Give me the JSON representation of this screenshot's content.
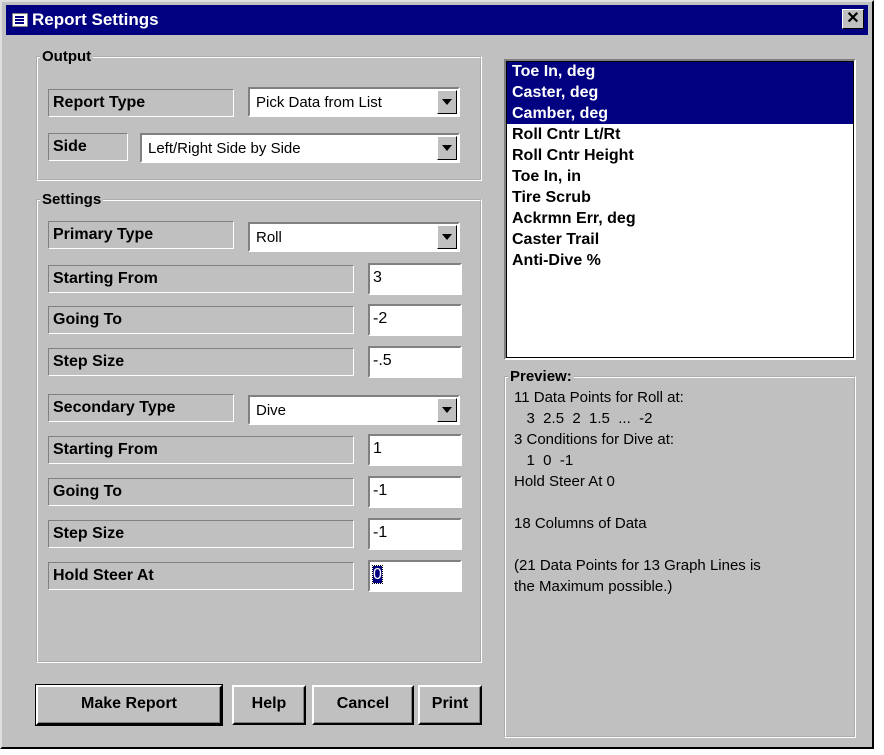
{
  "window": {
    "title": "Report Settings",
    "close_label": "✕"
  },
  "output": {
    "legend": "Output",
    "report_type_label": "Report Type",
    "report_type_value": "Pick Data from List",
    "side_label": "Side",
    "side_value": "Left/Right Side by Side"
  },
  "settings": {
    "legend": "Settings",
    "primary_type_label": "Primary Type",
    "primary_type_value": "Roll",
    "primary_start_label": "Starting From",
    "primary_start_value": "3",
    "primary_goto_label": "Going To",
    "primary_goto_value": "-2",
    "primary_step_label": "Step Size",
    "primary_step_value": "-.5",
    "secondary_type_label": "Secondary Type",
    "secondary_type_value": "Dive",
    "secondary_start_label": "Starting From",
    "secondary_start_value": "1",
    "secondary_goto_label": "Going To",
    "secondary_goto_value": "-1",
    "secondary_step_label": "Step Size",
    "secondary_step_value": "-1",
    "hold_steer_label": "Hold Steer At",
    "hold_steer_value": "0"
  },
  "data_list": {
    "items": [
      {
        "label": "Toe In, deg",
        "selected": true
      },
      {
        "label": "Caster, deg",
        "selected": true
      },
      {
        "label": "Camber, deg",
        "selected": true
      },
      {
        "label": "Roll Cntr Lt/Rt",
        "selected": false
      },
      {
        "label": "Roll Cntr Height",
        "selected": false
      },
      {
        "label": "Toe In, in",
        "selected": false
      },
      {
        "label": "Tire Scrub",
        "selected": false
      },
      {
        "label": "Ackrmn Err, deg",
        "selected": false
      },
      {
        "label": "Caster Trail",
        "selected": false
      },
      {
        "label": "Anti-Dive %",
        "selected": false
      }
    ]
  },
  "preview": {
    "legend": "Preview:",
    "lines": [
      "11 Data Points for Roll at:",
      "   3  2.5  2  1.5  ...  -2",
      "3 Conditions for Dive at:",
      "   1  0  -1",
      "Hold Steer At 0",
      "",
      "18 Columns of Data",
      "",
      "(21 Data Points for 13 Graph Lines is",
      "the Maximum possible.)"
    ]
  },
  "buttons": {
    "make_report": "Make Report",
    "help": "Help",
    "cancel": "Cancel",
    "print": "Print"
  },
  "colors": {
    "titlebar": "#000080",
    "face": "#c0c0c0",
    "selection": "#000080"
  }
}
